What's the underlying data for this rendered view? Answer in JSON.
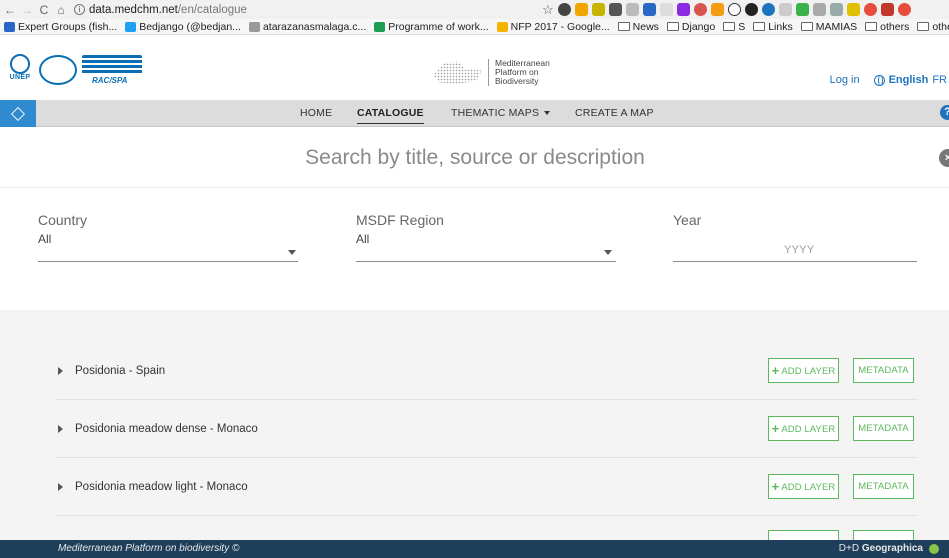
{
  "browser": {
    "url_domain": "data.medchm.net",
    "url_path": "/en/catalogue",
    "bookmarks": [
      {
        "label": "Expert Groups (fish...",
        "color": "#2a66c4"
      },
      {
        "label": "Bedjango (@bedjan...",
        "color": "#1da1f2"
      },
      {
        "label": "atarazanasmalaga.c...",
        "color": "#999999"
      },
      {
        "label": "Programme of work...",
        "color": "#1e9e55"
      },
      {
        "label": "NFP 2017 - Google...",
        "color": "#f4b400"
      },
      {
        "label": "News",
        "folder": true
      },
      {
        "label": "Django",
        "folder": true
      },
      {
        "label": "S",
        "folder": true
      },
      {
        "label": "Links",
        "folder": true
      },
      {
        "label": "MAMIAS",
        "folder": true
      },
      {
        "label": "others",
        "folder": true
      },
      {
        "label": "other",
        "folder": true
      }
    ]
  },
  "header": {
    "unep_label": "UNEP",
    "rac_label": "RAC/SPA",
    "brand_line1": "Mediterranean",
    "brand_line2": "Platform on",
    "brand_line3": "Biodiversity",
    "login": "Log in",
    "language": "English",
    "alt_language": "FR"
  },
  "nav": {
    "home": "HOME",
    "catalogue": "CATALOGUE",
    "thematic_maps": "THEMATIC MAPS",
    "create_map": "CREATE A MAP",
    "help": "?"
  },
  "search": {
    "placeholder": "Search by title, source or description",
    "clear": "×"
  },
  "filters": {
    "country_label": "Country",
    "country_value": "All",
    "region_label": "MSDF Region",
    "region_value": "All",
    "year_label": "Year",
    "year_placeholder": "YYYY"
  },
  "rows": [
    {
      "name": "Posidonia - Spain",
      "add": "ADD LAYER",
      "meta": "METADATA"
    },
    {
      "name": "Posidonia meadow dense - Monaco",
      "add": "ADD LAYER",
      "meta": "METADATA"
    },
    {
      "name": "Posidonia meadow light - Monaco",
      "add": "ADD LAYER",
      "meta": "METADATA"
    }
  ],
  "footer": {
    "left": "Mediterranean Platform on biodiversity ©",
    "right_prefix": "D+D",
    "right_brand": "Geographica"
  },
  "colors": {
    "accent_blue": "#1e73be",
    "button_green": "#5cb85c",
    "footer_bg": "#1f3e5a"
  }
}
